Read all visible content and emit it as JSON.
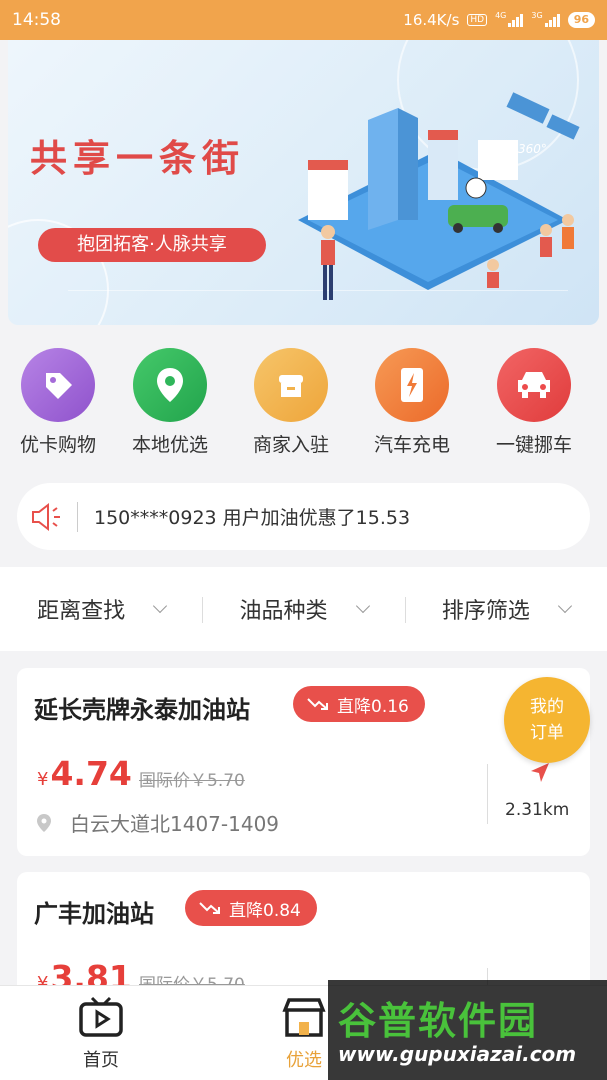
{
  "status_bar": {
    "time": "14:58",
    "speed": "16.4K/s",
    "hd": "HD",
    "sig1_label": "4G",
    "sig2_label": "3G",
    "battery": "96"
  },
  "banner": {
    "title": "共享一条街",
    "subtitle": "抱团拓客·人脉共享",
    "badge": "360°"
  },
  "shortcuts": [
    {
      "label": "优卡购物",
      "icon": "tag-icon",
      "color": "#a56bd8"
    },
    {
      "label": "本地优选",
      "icon": "location-pin-icon",
      "color": "#2fb65a"
    },
    {
      "label": "商家入驻",
      "icon": "shop-icon",
      "color": "#f2b24b"
    },
    {
      "label": "汽车充电",
      "icon": "charging-icon",
      "color": "#f07a38"
    },
    {
      "label": "一键挪车",
      "icon": "car-icon",
      "color": "#ec4b4b"
    }
  ],
  "notice": {
    "text": "150****0923 用户加油优惠了15.53"
  },
  "filters": [
    {
      "label": "距离查找"
    },
    {
      "label": "油品种类"
    },
    {
      "label": "排序筛选"
    }
  ],
  "stations": [
    {
      "name": "延长壳牌永泰加油站",
      "drop": "直降0.16",
      "currency": "¥",
      "price": "4.74",
      "intl_price": "国际价￥5.70",
      "address": "白云大道北1407-1409",
      "distance": "2.31km"
    },
    {
      "name": "广丰加油站",
      "drop": "直降0.84",
      "currency": "¥",
      "price": "3.81",
      "intl_price": "国际价￥5.70"
    }
  ],
  "order_button": {
    "line1": "我的",
    "line2": "订单"
  },
  "tabbar": [
    {
      "label": "首页",
      "icon": "video-play-icon"
    },
    {
      "label": "优选",
      "icon": "shop-icon"
    }
  ],
  "watermark": {
    "title": "谷普软件园",
    "url": "www.gupuxiazai.com"
  },
  "colors": {
    "status_bar": "#f1a44c",
    "price_red": "#e63f3a",
    "badge_red": "#e8504b",
    "order_orange": "#f5b531",
    "tab_active": "#e8a23a"
  }
}
